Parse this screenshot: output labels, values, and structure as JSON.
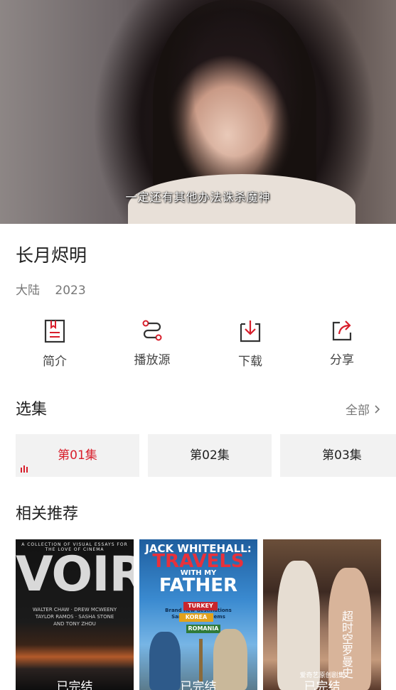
{
  "player": {
    "subtitle": "一定还有其他办法诛杀魔神"
  },
  "show": {
    "title": "长月烬明",
    "region": "大陆",
    "year": "2023"
  },
  "actions": [
    {
      "label": "简介",
      "icon": "document-icon"
    },
    {
      "label": "播放源",
      "icon": "route-icon"
    },
    {
      "label": "下载",
      "icon": "download-icon"
    },
    {
      "label": "分享",
      "icon": "share-icon"
    }
  ],
  "episodes_section": {
    "title": "选集",
    "more_label": "全部"
  },
  "episodes": [
    {
      "label": "第01集",
      "active": true
    },
    {
      "label": "第02集",
      "active": false
    },
    {
      "label": "第03集",
      "active": false
    }
  ],
  "recommend_section": {
    "title": "相关推荐"
  },
  "posters": [
    {
      "top_text": "A COLLECTION OF VISUAL ESSAYS FOR THE LOVE OF CINEMA",
      "title": "VOIR",
      "credits": [
        "WALTER CHAW · DREW MCWEENY",
        "TAYLOR RAMOS · SASHA STONE",
        "AND TONY ZHOU"
      ],
      "caption": "已完结"
    },
    {
      "top_text": "JACK WHITEHALL:",
      "title_line1": "TRAVELS",
      "title_mid": "WITH MY",
      "title_line2": "FATHER",
      "tagline": [
        "Brand new destinations",
        "Same old problems"
      ],
      "signs": [
        "TURKEY",
        "KOREA",
        "ROMANIA"
      ],
      "caption": "已完结"
    },
    {
      "title": "超时空罗曼史",
      "tag": "爱奇艺原创剧集",
      "caption": "已完结"
    }
  ],
  "colors": {
    "accent": "#d81e2b",
    "text": "#222222",
    "muted": "#777777",
    "tile": "#f2f2f2"
  }
}
